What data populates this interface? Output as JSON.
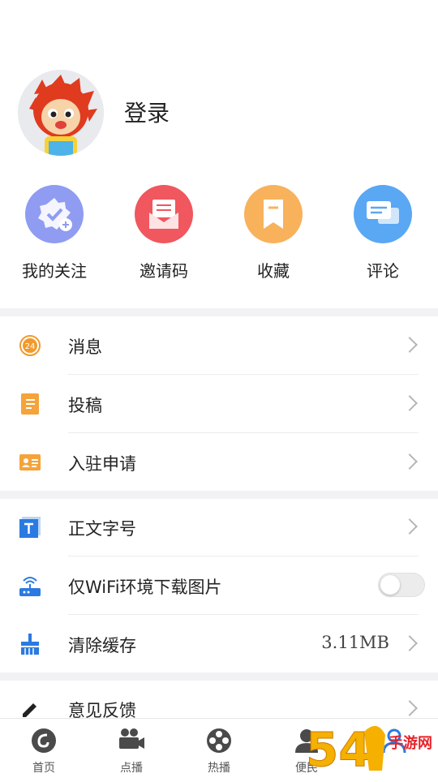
{
  "profile": {
    "login_text": "登录"
  },
  "quick_actions": [
    {
      "label": "我的关注",
      "icon": "follow-badge-icon",
      "color": "#8f9cf2"
    },
    {
      "label": "邀请码",
      "icon": "invite-envelope-icon",
      "color": "#f0575e"
    },
    {
      "label": "收藏",
      "icon": "bookmark-icon",
      "color": "#f8b25c"
    },
    {
      "label": "评论",
      "icon": "comment-bubble-icon",
      "color": "#5aa7f3"
    }
  ],
  "menu_group1": [
    {
      "label": "消息",
      "icon": "message-24-icon"
    },
    {
      "label": "投稿",
      "icon": "document-icon"
    },
    {
      "label": "入驻申请",
      "icon": "id-card-icon"
    }
  ],
  "menu_group2": [
    {
      "label": "正文字号",
      "icon": "font-size-icon"
    },
    {
      "label": "仅WiFi环境下载图片",
      "icon": "wifi-router-icon",
      "toggle_on": false
    },
    {
      "label": "清除缓存",
      "icon": "broom-icon",
      "value": "3.11MB"
    }
  ],
  "menu_group3": [
    {
      "label": "意见反馈",
      "icon": "pencil-icon"
    }
  ],
  "tabbar": [
    {
      "label": "首页",
      "icon": "home-logo-icon"
    },
    {
      "label": "点播",
      "icon": "video-camera-icon"
    },
    {
      "label": "热播",
      "icon": "film-reel-icon"
    },
    {
      "label": "便民",
      "icon": "person-icon"
    },
    {
      "label": "",
      "icon": "user-icon"
    }
  ],
  "watermark": {
    "text": "手游网",
    "number": "54"
  },
  "colors": {
    "accent": "#2a7ae2",
    "separator": "#f2f2f4"
  }
}
